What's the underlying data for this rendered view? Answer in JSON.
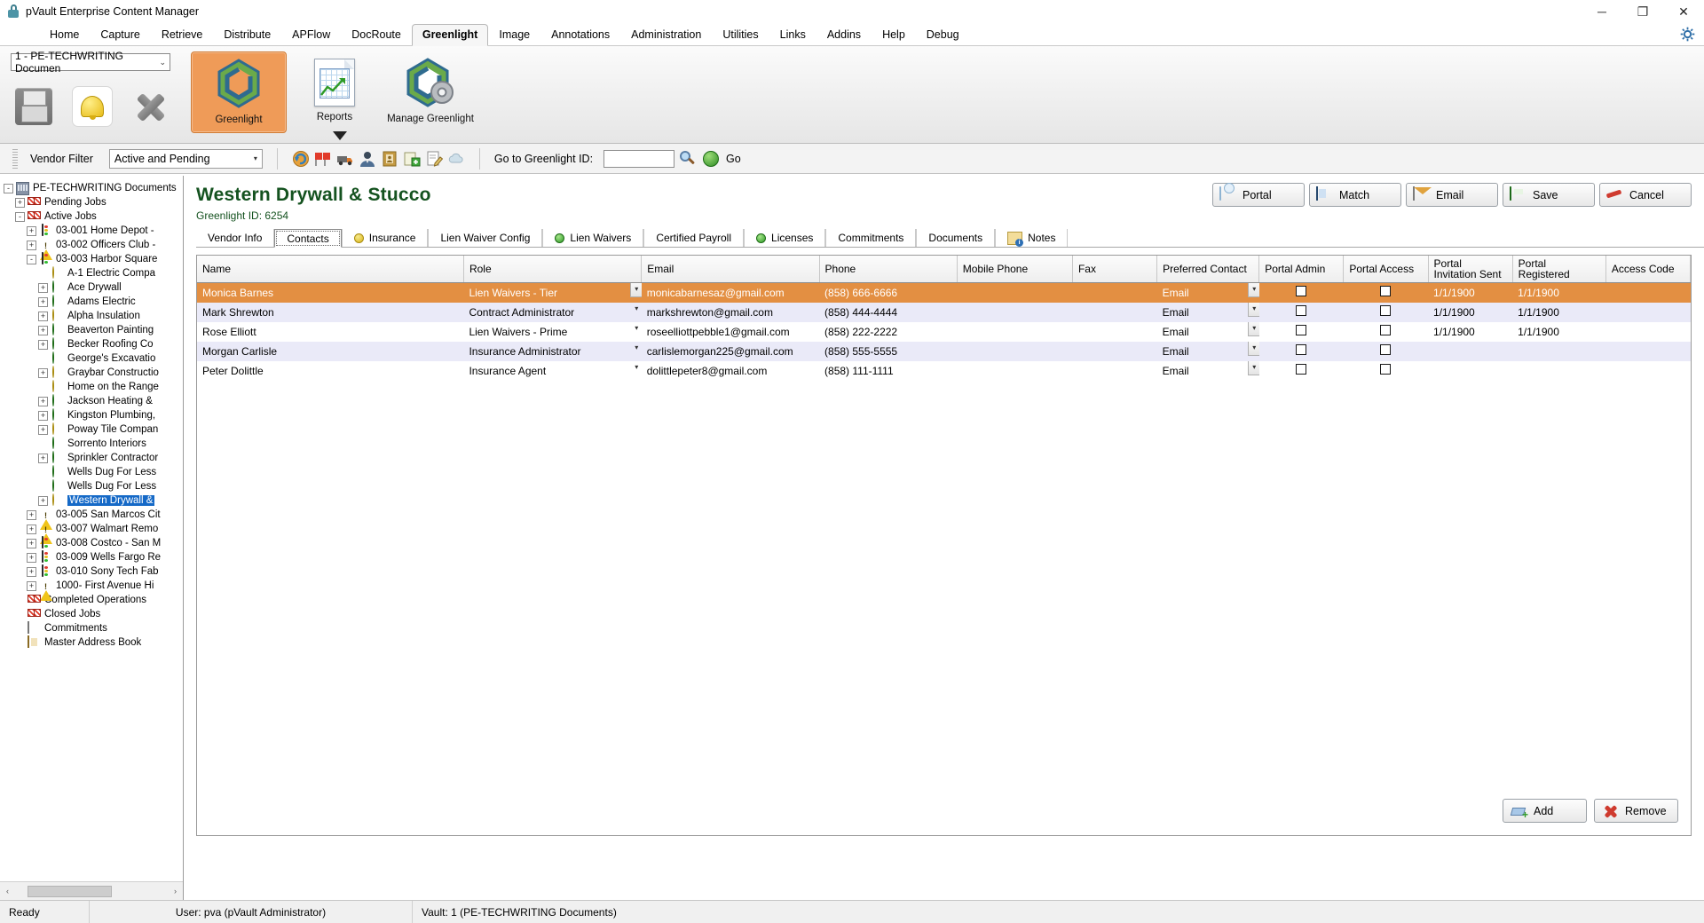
{
  "window": {
    "title": "pVault Enterprise Content Manager",
    "minimize": "─",
    "maximize": "❐",
    "close": "✕"
  },
  "menu": {
    "items": [
      {
        "label": "Home",
        "active": false
      },
      {
        "label": "Capture",
        "active": false
      },
      {
        "label": "Retrieve",
        "active": false
      },
      {
        "label": "Distribute",
        "active": false
      },
      {
        "label": "APFlow",
        "active": false
      },
      {
        "label": "DocRoute",
        "active": false
      },
      {
        "label": "Greenlight",
        "active": true
      },
      {
        "label": "Image",
        "active": false
      },
      {
        "label": "Annotations",
        "active": false
      },
      {
        "label": "Administration",
        "active": false
      },
      {
        "label": "Utilities",
        "active": false
      },
      {
        "label": "Links",
        "active": false
      },
      {
        "label": "Addins",
        "active": false
      },
      {
        "label": "Help",
        "active": false
      },
      {
        "label": "Debug",
        "active": false
      }
    ]
  },
  "ribbon": {
    "vault_select": "1 - PE-TECHWRITING Documen",
    "vault_caret": "⌄",
    "quick_buttons": [
      "save-icon",
      "alerts-icon",
      "close-icon"
    ],
    "groups": [
      {
        "label": "Greenlight",
        "selected": true
      },
      {
        "label": "Reports",
        "selected": false
      },
      {
        "label": "Manage Greenlight",
        "selected": false
      }
    ]
  },
  "filterbar": {
    "vendor_filter_label": "Vendor Filter",
    "vendor_filter_value": "Active and Pending",
    "caret": "▾",
    "goto_label": "Go to Greenlight ID:",
    "goto_value": "",
    "go_label": "Go"
  },
  "tree": {
    "nodes": [
      {
        "label": "PE-TECHWRITING Documents",
        "indent": 0,
        "expander": "-",
        "icon": "building-icon",
        "selected": false
      },
      {
        "label": "Pending Jobs",
        "indent": 1,
        "expander": "+",
        "icon": "flags-icon",
        "selected": false
      },
      {
        "label": "Active Jobs",
        "indent": 1,
        "expander": "-",
        "icon": "flags-icon",
        "selected": false
      },
      {
        "label": "03-001  Home Depot -",
        "indent": 2,
        "expander": "+",
        "icon": "signal-icon",
        "selected": false
      },
      {
        "label": "03-002  Officers Club -",
        "indent": 2,
        "expander": "+",
        "icon": "warning-icon",
        "selected": false
      },
      {
        "label": "03-003  Harbor Square",
        "indent": 2,
        "expander": "-",
        "icon": "signal-icon",
        "selected": false
      },
      {
        "label": "A-1 Electric Compa",
        "indent": 3,
        "expander": "",
        "icon": "dot-yellow",
        "selected": false
      },
      {
        "label": "Ace Drywall",
        "indent": 3,
        "expander": "+",
        "icon": "dot-green",
        "selected": false
      },
      {
        "label": "Adams Electric",
        "indent": 3,
        "expander": "+",
        "icon": "dot-green",
        "selected": false
      },
      {
        "label": "Alpha Insulation",
        "indent": 3,
        "expander": "+",
        "icon": "dot-yellow",
        "selected": false
      },
      {
        "label": "Beaverton Painting",
        "indent": 3,
        "expander": "+",
        "icon": "dot-green",
        "selected": false
      },
      {
        "label": "Becker Roofing Co",
        "indent": 3,
        "expander": "+",
        "icon": "dot-green",
        "selected": false
      },
      {
        "label": "George's Excavatio",
        "indent": 3,
        "expander": "",
        "icon": "dot-green",
        "selected": false
      },
      {
        "label": "Graybar Constructio",
        "indent": 3,
        "expander": "+",
        "icon": "dot-yellow",
        "selected": false
      },
      {
        "label": "Home on the Range",
        "indent": 3,
        "expander": "",
        "icon": "dot-yellow",
        "selected": false
      },
      {
        "label": "Jackson Heating &",
        "indent": 3,
        "expander": "+",
        "icon": "dot-green",
        "selected": false
      },
      {
        "label": "Kingston Plumbing,",
        "indent": 3,
        "expander": "+",
        "icon": "dot-green",
        "selected": false
      },
      {
        "label": "Poway Tile Compan",
        "indent": 3,
        "expander": "+",
        "icon": "dot-yellow",
        "selected": false
      },
      {
        "label": "Sorrento Interiors",
        "indent": 3,
        "expander": "",
        "icon": "dot-green",
        "selected": false
      },
      {
        "label": "Sprinkler Contractor",
        "indent": 3,
        "expander": "+",
        "icon": "dot-green",
        "selected": false
      },
      {
        "label": "Wells Dug For Less",
        "indent": 3,
        "expander": "",
        "icon": "dot-green",
        "selected": false
      },
      {
        "label": "Wells Dug For Less",
        "indent": 3,
        "expander": "",
        "icon": "dot-green",
        "selected": false
      },
      {
        "label": "Western Drywall &",
        "indent": 3,
        "expander": "+",
        "icon": "dot-yellow",
        "selected": true
      },
      {
        "label": "03-005  San Marcos Cit",
        "indent": 2,
        "expander": "+",
        "icon": "warning-icon",
        "selected": false
      },
      {
        "label": "03-007  Walmart Remo",
        "indent": 2,
        "expander": "+",
        "icon": "warning-icon",
        "selected": false
      },
      {
        "label": "03-008  Costco - San M",
        "indent": 2,
        "expander": "+",
        "icon": "signal-icon",
        "selected": false
      },
      {
        "label": "03-009  Wells Fargo Re",
        "indent": 2,
        "expander": "+",
        "icon": "signal-icon",
        "selected": false
      },
      {
        "label": "03-010  Sony Tech Fab",
        "indent": 2,
        "expander": "+",
        "icon": "signal-icon",
        "selected": false
      },
      {
        "label": "1000-  First  Avenue Hi",
        "indent": 2,
        "expander": "+",
        "icon": "warning-icon",
        "selected": false
      },
      {
        "label": "Completed Operations",
        "indent": 1,
        "expander": "",
        "icon": "flags-icon",
        "selected": false
      },
      {
        "label": "Closed Jobs",
        "indent": 1,
        "expander": "",
        "icon": "flags-icon",
        "selected": false
      },
      {
        "label": "Commitments",
        "indent": 1,
        "expander": "",
        "icon": "po-icon",
        "selected": false
      },
      {
        "label": "Master Address Book",
        "indent": 1,
        "expander": "",
        "icon": "address-book-icon",
        "selected": false
      }
    ],
    "scroll_left": "‹",
    "scroll_right": "›"
  },
  "page": {
    "job_title": "Western Drywall & Stucco",
    "greenlight_id_label": "Greenlight ID: 6254",
    "buttons": [
      {
        "label": "Portal",
        "icon": "cloud-icon"
      },
      {
        "label": "Match",
        "icon": "match-icon"
      },
      {
        "label": "Email",
        "icon": "email-icon"
      },
      {
        "label": "Save",
        "icon": "save-icon"
      },
      {
        "label": "Cancel",
        "icon": "cancel-icon"
      }
    ]
  },
  "tabs": [
    {
      "label": "Vendor Info",
      "dot": "",
      "active": false
    },
    {
      "label": "Contacts",
      "dot": "",
      "active": true
    },
    {
      "label": "Insurance",
      "dot": "yellow",
      "active": false
    },
    {
      "label": "Lien Waiver Config",
      "dot": "",
      "active": false
    },
    {
      "label": "Lien Waivers",
      "dot": "green",
      "active": false
    },
    {
      "label": "Certified Payroll",
      "dot": "",
      "active": false
    },
    {
      "label": "Licenses",
      "dot": "green",
      "active": false
    },
    {
      "label": "Commitments",
      "dot": "",
      "active": false
    },
    {
      "label": "Documents",
      "dot": "",
      "active": false
    },
    {
      "label": "Notes",
      "dot": "note",
      "active": false
    }
  ],
  "grid": {
    "columns": [
      "Name",
      "Role",
      "Email",
      "Phone",
      "Mobile Phone",
      "Fax",
      "Preferred Contact",
      "Portal Admin",
      "Portal Access",
      "Portal Invitation Sent",
      "Portal Registered",
      "Access Code"
    ],
    "rows": [
      {
        "selected": true,
        "name": "Monica Barnes",
        "role": "Lien Waivers - Tier",
        "email": "monicabarnesaz@gmail.com",
        "phone": "(858) 666-6666",
        "mobile": "",
        "fax": "",
        "preferred": "Email",
        "portal_admin": false,
        "portal_access": false,
        "invite_sent": "1/1/1900",
        "registered": "1/1/1900",
        "access_code": ""
      },
      {
        "selected": false,
        "name": "Mark Shrewton",
        "role": "Contract Administrator",
        "email": "markshrewton@gmail.com",
        "phone": "(858) 444-4444",
        "mobile": "",
        "fax": "",
        "preferred": "Email",
        "portal_admin": false,
        "portal_access": false,
        "invite_sent": "1/1/1900",
        "registered": "1/1/1900",
        "access_code": ""
      },
      {
        "selected": false,
        "name": "Rose Elliott",
        "role": "Lien Waivers - Prime",
        "email": "roseelliottpebble1@gmail.com",
        "phone": "(858) 222-2222",
        "mobile": "",
        "fax": "",
        "preferred": "Email",
        "portal_admin": false,
        "portal_access": false,
        "invite_sent": "1/1/1900",
        "registered": "1/1/1900",
        "access_code": ""
      },
      {
        "selected": false,
        "name": "Morgan Carlisle",
        "role": "Insurance Administrator",
        "email": "carlislemorgan225@gmail.com",
        "phone": "(858) 555-5555",
        "mobile": "",
        "fax": "",
        "preferred": "Email",
        "portal_admin": false,
        "portal_access": false,
        "invite_sent": "",
        "registered": "",
        "access_code": ""
      },
      {
        "selected": false,
        "name": "Peter Dolittle",
        "role": "Insurance Agent",
        "email": "dolittlepeter8@gmail.com",
        "phone": "(858) 111-1111",
        "mobile": "",
        "fax": "",
        "preferred": "Email",
        "portal_admin": false,
        "portal_access": false,
        "invite_sent": "",
        "registered": "",
        "access_code": ""
      }
    ],
    "add_label": "Add",
    "remove_label": "Remove"
  },
  "statusbar": {
    "state": "Ready",
    "user": "User: pva (pVault Administrator)",
    "vault": "Vault: 1 (PE-TECHWRITING Documents)"
  },
  "colors": {
    "selection_orange": "#e38f42",
    "tree_selection_blue": "#1569c7",
    "title_green": "#14521f",
    "ribbon_selected": "#ef9b58"
  }
}
